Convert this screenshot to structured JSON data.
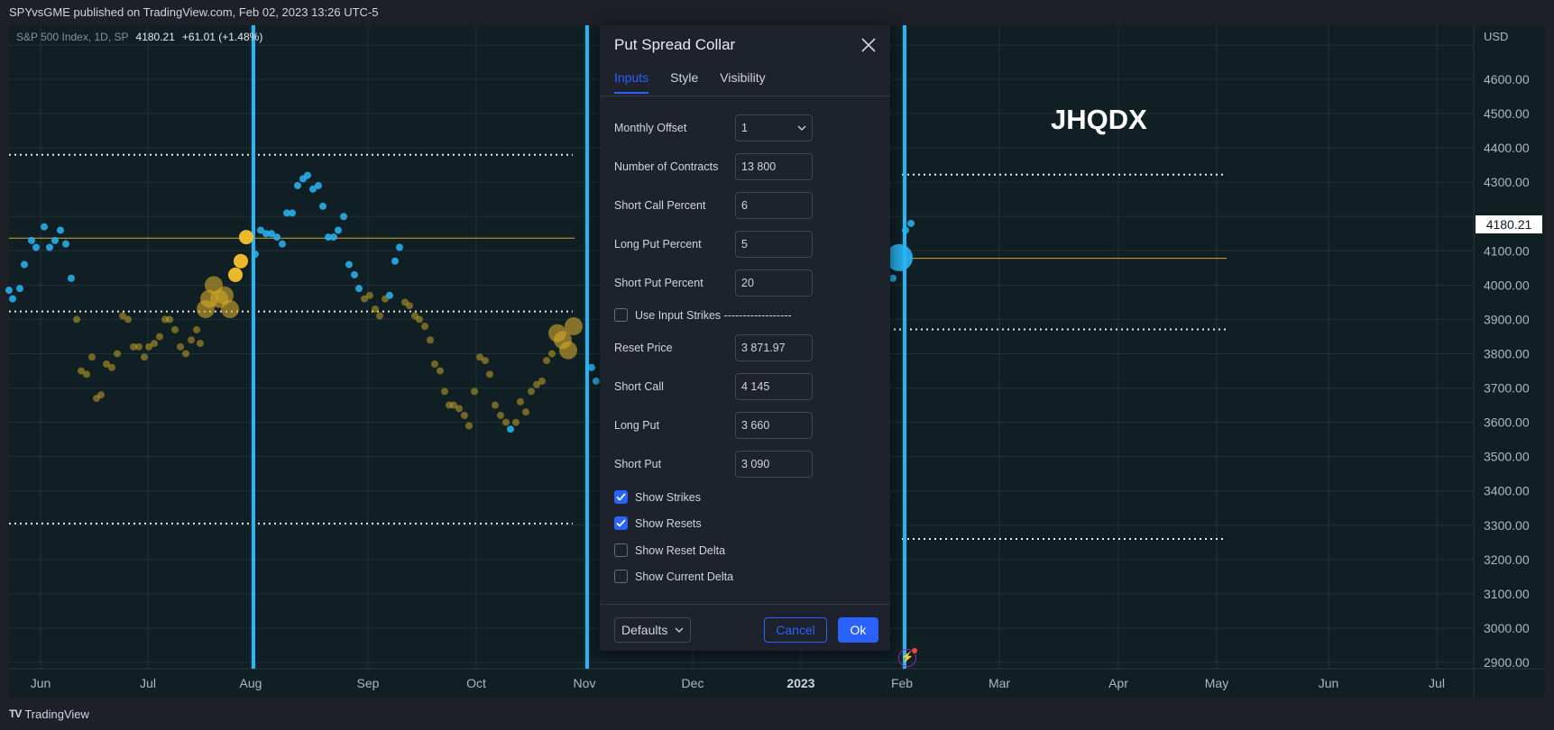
{
  "header": {
    "text": "SPYvsGME published on TradingView.com, Feb 02, 2023 13:26 UTC-5"
  },
  "legend": {
    "symbol": "S&P 500 Index, 1D, SP",
    "price": "4180.21",
    "change": "+61.01 (+1.48%)"
  },
  "watermark": "JHQDX",
  "axis": {
    "currency": "USD",
    "price_labels": [
      "4600.00",
      "4500.00",
      "4400.00",
      "4300.00",
      "4100.00",
      "4000.00",
      "3900.00",
      "3800.00",
      "3700.00",
      "3600.00",
      "3500.00",
      "3400.00",
      "3300.00",
      "3200.00",
      "3100.00",
      "3000.00",
      "2900.00"
    ],
    "current_price": "4180.21",
    "time_labels": [
      "Jun",
      "Jul",
      "Aug",
      "Sep",
      "Oct",
      "Nov",
      "Dec",
      "2023",
      "Feb",
      "Mar",
      "Apr",
      "May",
      "Jun",
      "Jul"
    ]
  },
  "colors": {
    "accent": "#2962ff",
    "cyan_marker": "#29b6f6",
    "gold": "#f9c22e",
    "chart_bg": "#0f1f24"
  },
  "dialog": {
    "title": "Put Spread Collar",
    "tabs": [
      {
        "label": "Inputs",
        "active": true
      },
      {
        "label": "Style",
        "active": false
      },
      {
        "label": "Visibility",
        "active": false
      }
    ],
    "fields": {
      "monthly_offset": {
        "label": "Monthly Offset",
        "value": "1"
      },
      "contracts": {
        "label": "Number of Contracts",
        "value": "13 800"
      },
      "short_call_pct": {
        "label": "Short Call Percent",
        "value": "6"
      },
      "long_put_pct": {
        "label": "Long Put Percent",
        "value": "5"
      },
      "short_put_pct": {
        "label": "Short Put Percent",
        "value": "20"
      },
      "use_input_strikes": {
        "label": "Use Input Strikes ------------------",
        "checked": false
      },
      "reset_price": {
        "label": "Reset Price",
        "value": "3 871.97"
      },
      "short_call": {
        "label": "Short Call",
        "value": "4 145"
      },
      "long_put": {
        "label": "Long Put",
        "value": "3 660"
      },
      "short_put": {
        "label": "Short Put",
        "value": "3 090"
      },
      "show_strikes": {
        "label": "Show Strikes",
        "checked": true
      },
      "show_resets": {
        "label": "Show Resets",
        "checked": true
      },
      "show_reset_delta": {
        "label": "Show Reset Delta",
        "checked": false
      },
      "show_current_delta": {
        "label": "Show Current Delta",
        "checked": false
      }
    },
    "defaults_label": "Defaults",
    "cancel_label": "Cancel",
    "ok_label": "Ok"
  },
  "footer": {
    "brand": "TradingView"
  }
}
